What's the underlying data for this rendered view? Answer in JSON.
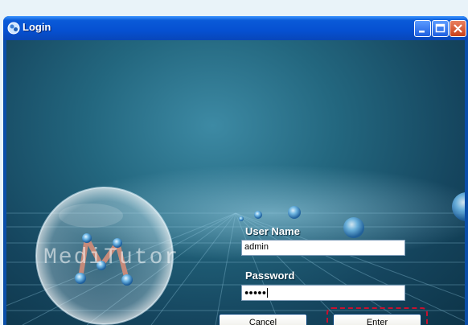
{
  "window": {
    "title": "Login"
  },
  "logo": {
    "text": "MediTutor"
  },
  "form": {
    "username_label": "User Name",
    "username_value": "admin",
    "password_label": "Password",
    "password_mask": "●●●●●"
  },
  "buttons": {
    "cancel_label": "Cancel",
    "enter_label": "Enter"
  },
  "colors": {
    "titlebar": "#0650d1",
    "background": "#23677f",
    "highlight": "#c8102e"
  }
}
